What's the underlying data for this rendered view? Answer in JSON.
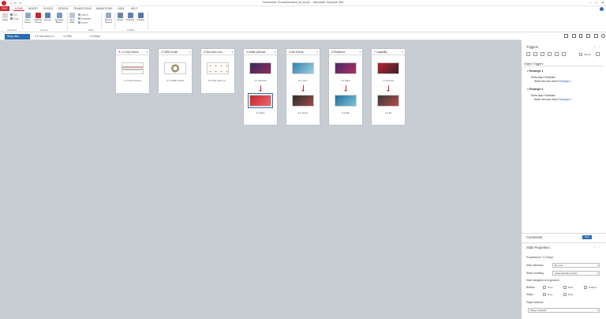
{
  "window": {
    "title": "Vulnerable Characteristics (2).story* - Articulate Storyline 360"
  },
  "ribbon_tabs": [
    "FILE",
    "HOME",
    "INSERT",
    "SLIDES",
    "DESIGN",
    "TRANSITIONS",
    "ANIMATIONS",
    "VIEW",
    "HELP"
  ],
  "ribbon": {
    "paste": "Paste",
    "cut": "Cut",
    "copy": "Copy",
    "clipboard_group": "Clipboard",
    "new_scene": "New Scene",
    "starting_scene": "Starting Scene",
    "scenes": "Scenes",
    "question_banks": "Question Banks",
    "new_slide": "New Slide",
    "layout": "Layout",
    "duplicate": "Duplicate",
    "import": "Import",
    "slide_group": "Slide",
    "record_screen": "Record Screen",
    "player": "Player",
    "preview": "Preview",
    "publish": "Publish",
    "publish_group": "Publish",
    "scenes_group": "Scenes"
  },
  "storybar": {
    "story_view": "Story view",
    "crumb1": "3.1 How does vu…",
    "crumb2": "4.2 Ella",
    "crumb3": "4.2 Mary"
  },
  "scenes": [
    {
      "title": "1.4 Key Drivers",
      "slides": [
        {
          "label": "1.1 4 Key Drivers",
          "thumb": "chart"
        }
      ]
    },
    {
      "title": "2 CARE model",
      "slides": [
        {
          "label": "2.1 CARE model",
          "thumb": "donut"
        }
      ]
    },
    {
      "title": "3 How does vuln…",
      "slides": [
        {
          "label": "3.1 How does vu…",
          "thumb": "icons"
        }
      ]
    },
    {
      "title": "4 Health (interact…",
      "slides": [
        {
          "label": "4.1 Hannah",
          "thumb": "health1"
        },
        {
          "label": "4.2 Mary",
          "thumb": "health2"
        }
      ]
    },
    {
      "title": "5 Life Events",
      "slides": [
        {
          "label": "5.1 John",
          "thumb": "life1"
        },
        {
          "label": "5.2 Jacob",
          "thumb": "life2"
        }
      ]
    },
    {
      "title": "6 Resilience",
      "slides": [
        {
          "label": "6.1 Mark",
          "thumb": "res1"
        },
        {
          "label": "6.2 Ella",
          "thumb": "res2"
        }
      ]
    },
    {
      "title": "7 Capability",
      "slides": [
        {
          "label": "7.1 Antonio",
          "thumb": "cap1"
        },
        {
          "label": "7.2 Eli",
          "thumb": "cap2"
        }
      ]
    }
  ],
  "triggers_panel": {
    "title": "Triggers",
    "group_label": "Group",
    "section": "Object Triggers",
    "items": [
      {
        "object": "Rectangle 1",
        "action": "Show layer Feedback",
        "condition": "When the user clicks",
        "target": "Rectangle 1"
      },
      {
        "object": "Rectangle 2",
        "action": "Show layer Feedback",
        "condition": "When the user clicks",
        "target": "Rectangle 2"
      }
    ]
  },
  "comments_panel": {
    "title": "Comments",
    "new_label": "New"
  },
  "slide_properties": {
    "title": "Slide Properties",
    "properties_for": "Properties for \"4.2 Mary\"",
    "slide_advances_label": "Slide advances",
    "slide_advances_value": "By user",
    "when_revisiting_label": "When revisiting",
    "when_revisiting_value": "Automatically decide",
    "nav_section": "Slide navigation and gestures",
    "buttons_label": "Buttons",
    "swipe_label": "Swipe",
    "prev": "Prev",
    "next": "Next",
    "submit": "Submit",
    "player_features_label": "Player features",
    "player_features_value": "Player defaults"
  },
  "colors": {
    "accent": "#c8262e",
    "selection": "#2b6cb0",
    "canvas": "#c8cdd3"
  }
}
